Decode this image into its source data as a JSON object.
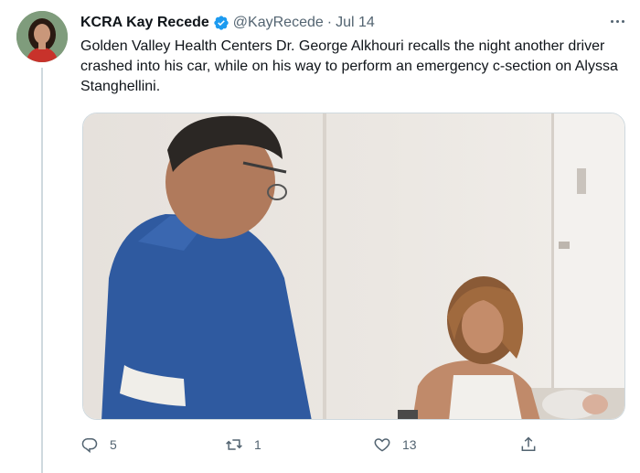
{
  "tweet": {
    "display_name": "KCRA Kay Recede",
    "handle": "@KayRecede",
    "separator": "·",
    "date": "Jul 14",
    "text": "Golden Valley Health Centers Dr. George Alkhouri recalls the night another driver crashed into his car, while on his way to perform an emergency c-section on Alyssa Stanghellini.",
    "verified_color": "#1d9bf0"
  },
  "actions": {
    "reply_count": "5",
    "retweet_count": "1",
    "like_count": "13"
  },
  "icons": {
    "more": "more-horizontal-icon",
    "reply": "reply-icon",
    "retweet": "retweet-icon",
    "like": "heart-icon",
    "share": "share-icon"
  }
}
